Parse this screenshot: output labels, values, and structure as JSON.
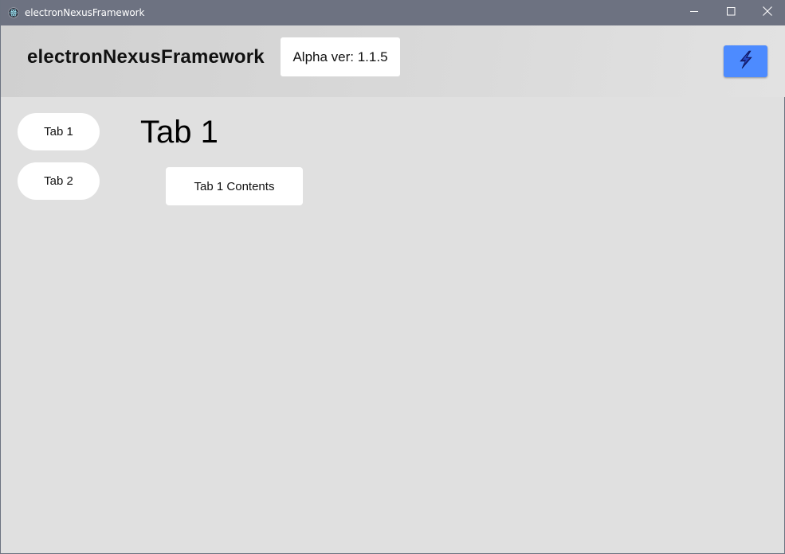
{
  "window": {
    "title": "electronNexusFramework",
    "controls": {
      "minimize_icon": "minimize-icon",
      "maximize_icon": "maximize-icon",
      "close_icon": "close-icon"
    }
  },
  "header": {
    "app_name": "electronNexusFramework",
    "version_label": "Alpha ver: 1.1.5",
    "power_button_icon": "lightning-bolt-icon"
  },
  "sidebar": {
    "tabs": [
      {
        "label": "Tab 1"
      },
      {
        "label": "Tab 2"
      }
    ]
  },
  "main": {
    "title": "Tab 1",
    "contents": "Tab 1 Contents"
  },
  "colors": {
    "titlebar": "#6d7281",
    "background": "#e0e0e0",
    "accent": "#4d8bff",
    "card": "#ffffff"
  }
}
